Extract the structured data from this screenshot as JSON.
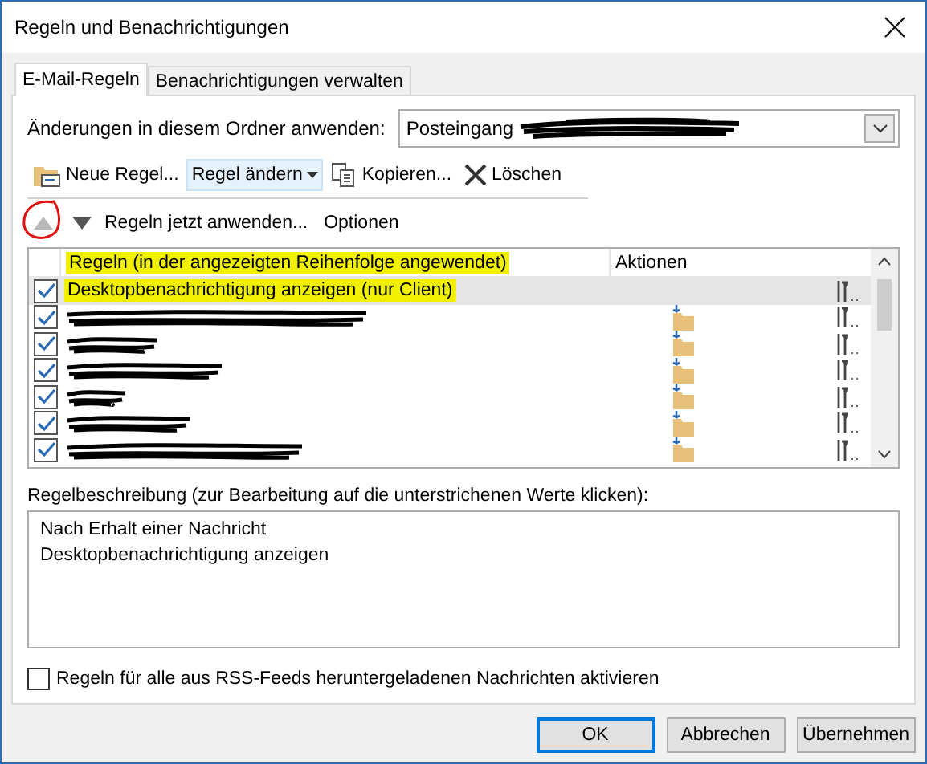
{
  "window": {
    "title": "Regeln und Benachrichtigungen"
  },
  "tabs": [
    {
      "label": "E-Mail-Regeln",
      "selected": true
    },
    {
      "label": "Benachrichtigungen verwalten",
      "selected": false
    }
  ],
  "folder": {
    "label": "Änderungen in diesem Ordner anwenden:",
    "value": "Posteingang",
    "redacted": true
  },
  "toolbar": [
    {
      "kind": "new",
      "label": "Neue Regel..."
    },
    {
      "kind": "edit",
      "label": "Regel ändern"
    },
    {
      "kind": "copy",
      "label": "Kopieren..."
    },
    {
      "kind": "delete",
      "label": "Löschen"
    }
  ],
  "toolbar2": {
    "apply": "Regeln jetzt anwenden...",
    "options": "Optionen",
    "up_annotated": true
  },
  "table": {
    "columns": [
      {
        "label": "Regeln (in der angezeigten Reihenfolge angewendet)",
        "highlighted": true
      },
      {
        "label": "Aktionen",
        "highlighted": false
      }
    ],
    "rows": [
      {
        "kind": "rule",
        "name": "Desktopbenachrichtigung anzeigen  (nur Client)",
        "checked": true,
        "selected": true,
        "highlighted": true,
        "move_action": false
      },
      {
        "kind": "redacted",
        "checked": true,
        "selected": false,
        "move_action": true
      },
      {
        "kind": "redacted",
        "checked": true,
        "selected": false,
        "move_action": true
      },
      {
        "kind": "redacted",
        "checked": true,
        "selected": false,
        "move_action": true
      },
      {
        "kind": "redacted",
        "checked": true,
        "selected": false,
        "move_action": true
      },
      {
        "kind": "redacted",
        "checked": true,
        "selected": false,
        "move_action": true
      },
      {
        "kind": "redacted",
        "checked": true,
        "selected": false,
        "move_action": true
      }
    ]
  },
  "description": {
    "label": "Regelbeschreibung (zur Bearbeitung auf die unterstrichenen Werte klicken):",
    "lines": [
      "Nach Erhalt einer Nachricht",
      "Desktopbenachrichtigung anzeigen"
    ]
  },
  "rss": {
    "label": "Regeln für alle aus RSS-Feeds heruntergeladenen Nachrichten aktivieren",
    "checked": false
  },
  "buttons": [
    {
      "label": "OK",
      "default": true
    },
    {
      "label": "Abbrechen",
      "default": false
    },
    {
      "label": "Übernehmen",
      "default": false
    }
  ]
}
